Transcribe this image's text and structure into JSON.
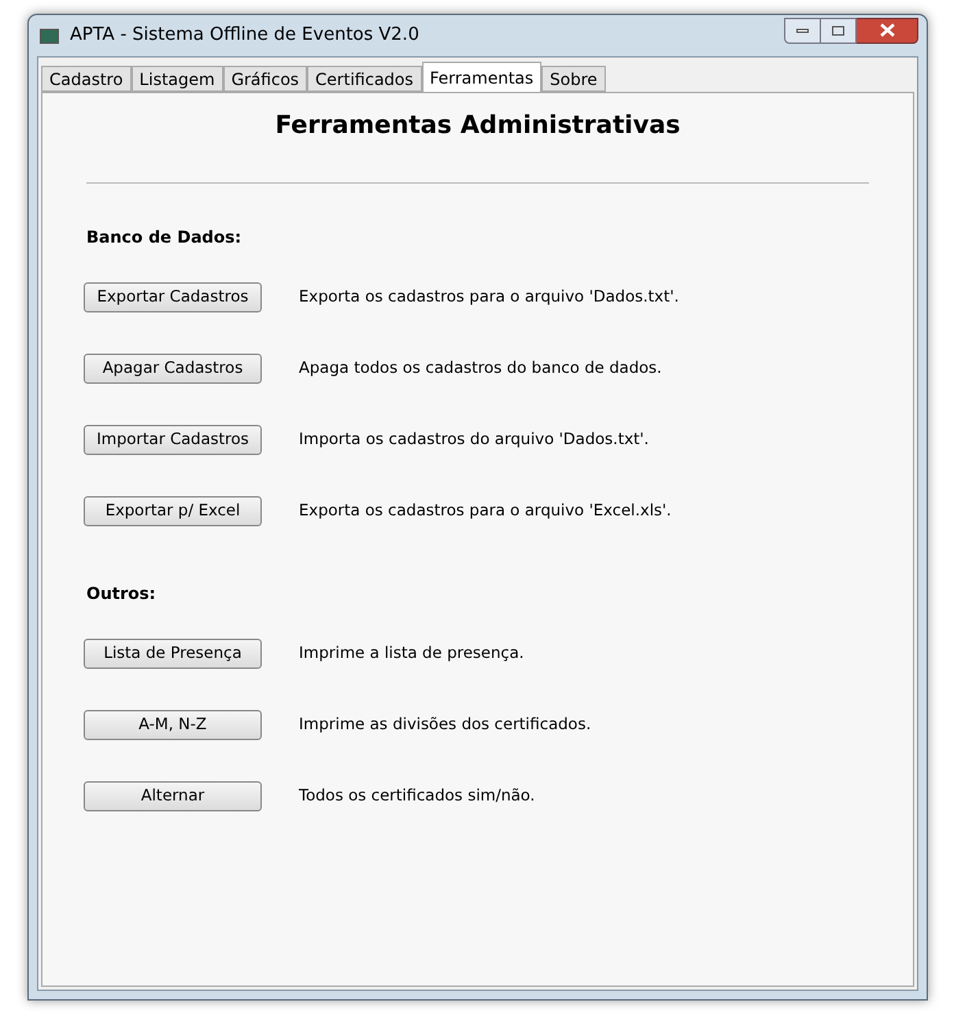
{
  "window": {
    "title": "APTA - Sistema Offline de Eventos V2.0"
  },
  "tabs": [
    {
      "label": "Cadastro",
      "selected": false
    },
    {
      "label": "Listagem",
      "selected": false
    },
    {
      "label": "Gráficos",
      "selected": false
    },
    {
      "label": "Certificados",
      "selected": false
    },
    {
      "label": "Ferramentas",
      "selected": true
    },
    {
      "label": "Sobre",
      "selected": false
    }
  ],
  "heading": "Ferramentas Administrativas",
  "sections": [
    {
      "title": "Banco de Dados:",
      "actions": [
        {
          "button": "Exportar Cadastros",
          "description": "Exporta os cadastros para o arquivo 'Dados.txt'."
        },
        {
          "button": "Apagar Cadastros",
          "description": "Apaga todos os cadastros do banco de dados."
        },
        {
          "button": "Importar Cadastros",
          "description": "Importa os cadastros do arquivo 'Dados.txt'."
        },
        {
          "button": "Exportar p/ Excel",
          "description": "Exporta os cadastros para o arquivo 'Excel.xls'."
        }
      ]
    },
    {
      "title": "Outros:",
      "actions": [
        {
          "button": "Lista de Presença",
          "description": "Imprime a lista de presença."
        },
        {
          "button": "A-M, N-Z",
          "description": "Imprime as divisões dos certificados."
        },
        {
          "button": "Alternar",
          "description": "Todos os certificados sim/não."
        }
      ]
    }
  ]
}
